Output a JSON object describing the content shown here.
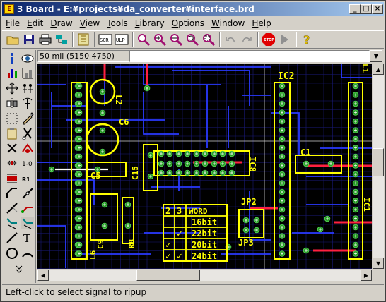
{
  "window": {
    "title": "3 Board - E:¥projects¥da_converter¥interface.brd",
    "icon_label": "E",
    "buttons": {
      "minimize": "_",
      "maximize": "□",
      "close": "×"
    }
  },
  "menu": [
    {
      "label": "File",
      "key": "F"
    },
    {
      "label": "Edit",
      "key": "E"
    },
    {
      "label": "Draw",
      "key": "D"
    },
    {
      "label": "View",
      "key": "V"
    },
    {
      "label": "Tools",
      "key": "T"
    },
    {
      "label": "Library",
      "key": "L"
    },
    {
      "label": "Options",
      "key": "O"
    },
    {
      "label": "Window",
      "key": "W"
    },
    {
      "label": "Help",
      "key": "H"
    }
  ],
  "command": {
    "coordinates": "50 mil (5150 4750)",
    "input_value": ""
  },
  "status": {
    "message": "Left-click to select signal to ripup"
  },
  "board": {
    "parts": [
      "IC2",
      "L2",
      "C6",
      "C5",
      "C15",
      "IC8",
      "C1",
      "C9",
      "R8",
      "L6",
      "JP2",
      "JP3",
      "L1",
      "IC1"
    ],
    "table": {
      "header": [
        "2",
        "3",
        "WORD"
      ],
      "rows": [
        {
          "c2": "",
          "c3": "",
          "word": "16bit"
        },
        {
          "c2": "",
          "c3": "✓",
          "word": "22bit"
        },
        {
          "c2": "✓",
          "c3": "",
          "word": "20bit"
        },
        {
          "c2": "✓",
          "c3": "✓",
          "word": "24bit"
        }
      ]
    }
  },
  "colors": {
    "canvas_bg": "#000000",
    "grid": "#1a1a7a",
    "silkscreen": "#ffff00",
    "bottom_trace": "#2a3aff",
    "top_trace": "#ff2040",
    "pad": "#2a9a2a"
  }
}
